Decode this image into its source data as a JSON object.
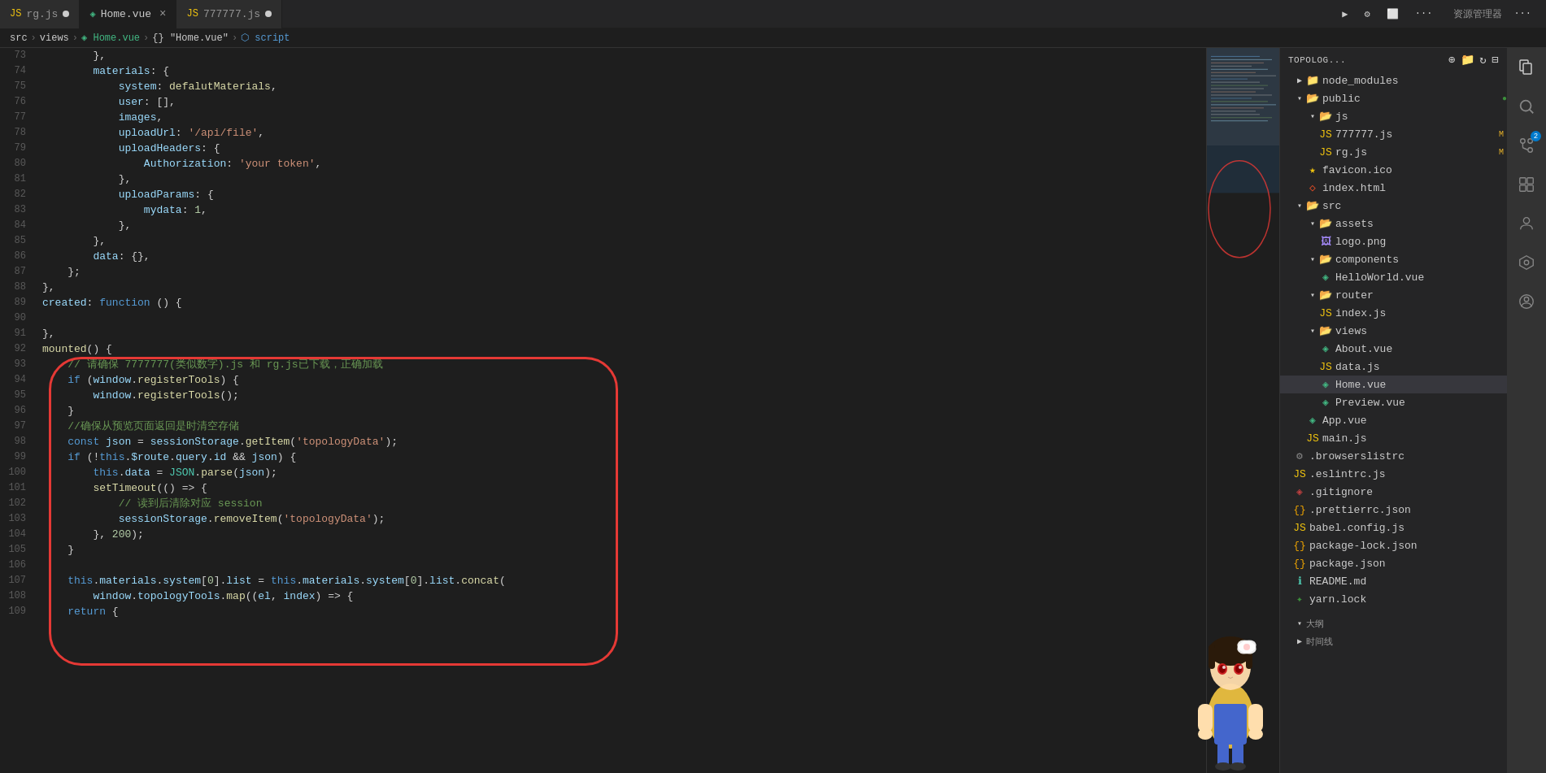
{
  "tabs": [
    {
      "id": "rg-js",
      "label": "rg.js",
      "type": "js",
      "modified": true,
      "active": false
    },
    {
      "id": "home-vue",
      "label": "Home.vue",
      "type": "vue",
      "modified": false,
      "active": true,
      "hasClose": true
    },
    {
      "id": "777777-js",
      "label": "777777.js",
      "type": "js",
      "modified": true,
      "active": false
    }
  ],
  "toolbar": {
    "run_label": "▶",
    "debug_label": "⚙",
    "layout_label": "⬜",
    "more_label": "...",
    "title": "资源管理器",
    "title_more": "..."
  },
  "breadcrumb": {
    "parts": [
      "src",
      "views",
      "Home.vue",
      "{} \"Home.vue\"",
      "script"
    ]
  },
  "code_lines": [
    {
      "num": 73,
      "content": "        },"
    },
    {
      "num": 74,
      "content": "        materials: {"
    },
    {
      "num": 75,
      "content": "            system: defalutMaterials,"
    },
    {
      "num": 76,
      "content": "            user: [],"
    },
    {
      "num": 77,
      "content": "            images,"
    },
    {
      "num": 78,
      "content": "            uploadUrl: '/api/file',"
    },
    {
      "num": 79,
      "content": "            uploadHeaders: {"
    },
    {
      "num": 80,
      "content": "                Authorization: 'your token',"
    },
    {
      "num": 81,
      "content": "            },"
    },
    {
      "num": 82,
      "content": "            uploadParams: {"
    },
    {
      "num": 83,
      "content": "                mydata: 1,"
    },
    {
      "num": 84,
      "content": "            },"
    },
    {
      "num": 85,
      "content": "        },"
    },
    {
      "num": 86,
      "content": "        data: {},"
    },
    {
      "num": 87,
      "content": "    };"
    },
    {
      "num": 88,
      "content": "},"
    },
    {
      "num": 89,
      "content": "created: function () {"
    },
    {
      "num": 90,
      "content": ""
    },
    {
      "num": 91,
      "content": "},"
    },
    {
      "num": 92,
      "content": "mounted() {"
    },
    {
      "num": 93,
      "content": "    // 请确保 7777777(类似数字).js 和 rg.js已下载，正确加载"
    },
    {
      "num": 94,
      "content": "    if (window.registerTools) {"
    },
    {
      "num": 95,
      "content": "        window.registerTools();"
    },
    {
      "num": 96,
      "content": "    }"
    },
    {
      "num": 97,
      "content": "    //确保从预览页面返回是时清空存储"
    },
    {
      "num": 98,
      "content": "    const json = sessionStorage.getItem('topologyData');"
    },
    {
      "num": 99,
      "content": "    if (!this.$route.query.id && json) {"
    },
    {
      "num": 100,
      "content": "        this.data = JSON.parse(json);"
    },
    {
      "num": 101,
      "content": "        setTimeout(() => {"
    },
    {
      "num": 102,
      "content": "            // 读到后清除对应 session"
    },
    {
      "num": 103,
      "content": "            sessionStorage.removeItem('topologyData');"
    },
    {
      "num": 104,
      "content": "        }, 200);"
    },
    {
      "num": 105,
      "content": "    }"
    },
    {
      "num": 106,
      "content": ""
    },
    {
      "num": 107,
      "content": "    this.materials.system[0].list = this.materials.system[0].list.concat("
    },
    {
      "num": 108,
      "content": "        window.topologyTools.map((el, index) => {"
    },
    {
      "num": 109,
      "content": "    return {"
    }
  ],
  "sidebar": {
    "title": "TOPOLOG...",
    "sections": {
      "node_modules": {
        "label": "node_modules",
        "collapsed": true
      },
      "public": {
        "label": "public",
        "collapsed": false,
        "children": {
          "js": {
            "label": "js",
            "collapsed": false,
            "children": [
              {
                "label": "777777.js",
                "type": "js",
                "badge": "M"
              },
              {
                "label": "rg.js",
                "type": "js",
                "badge": "M"
              }
            ]
          },
          "favicon": {
            "label": "favicon.ico",
            "type": "ico"
          },
          "index_html": {
            "label": "index.html",
            "type": "html"
          }
        }
      },
      "src": {
        "label": "src",
        "collapsed": false,
        "children": {
          "assets": {
            "label": "assets",
            "collapsed": false,
            "children": [
              {
                "label": "logo.png",
                "type": "png"
              }
            ]
          },
          "components": {
            "label": "components",
            "collapsed": false,
            "children": [
              {
                "label": "HelloWorld.vue",
                "type": "vue"
              }
            ]
          },
          "router": {
            "label": "router",
            "collapsed": false,
            "children": [
              {
                "label": "index.js",
                "type": "js"
              }
            ]
          },
          "views": {
            "label": "views",
            "collapsed": false,
            "children": [
              {
                "label": "About.vue",
                "type": "vue"
              },
              {
                "label": "data.js",
                "type": "js"
              },
              {
                "label": "Home.vue",
                "type": "vue",
                "selected": true
              },
              {
                "label": "Preview.vue",
                "type": "vue"
              }
            ]
          },
          "App.vue": {
            "label": "App.vue",
            "type": "vue"
          },
          "main.js": {
            "label": "main.js",
            "type": "js"
          }
        }
      },
      "browserslistrc": {
        "label": ".browserslistrc",
        "type": "config"
      },
      "eslintrc": {
        "label": ".eslintrc.js",
        "type": "js"
      },
      "gitignore": {
        "label": ".gitignore",
        "type": "git"
      },
      "prettierrc": {
        "label": ".prettierrc.json",
        "type": "json"
      },
      "babel": {
        "label": "babel.config.js",
        "type": "js"
      },
      "package_lock": {
        "label": "package-lock.json",
        "type": "json"
      },
      "package": {
        "label": "package.json",
        "type": "json"
      },
      "readme": {
        "label": "README.md",
        "type": "md"
      },
      "yarn_lock": {
        "label": "yarn.lock",
        "type": "yarn"
      }
    }
  }
}
